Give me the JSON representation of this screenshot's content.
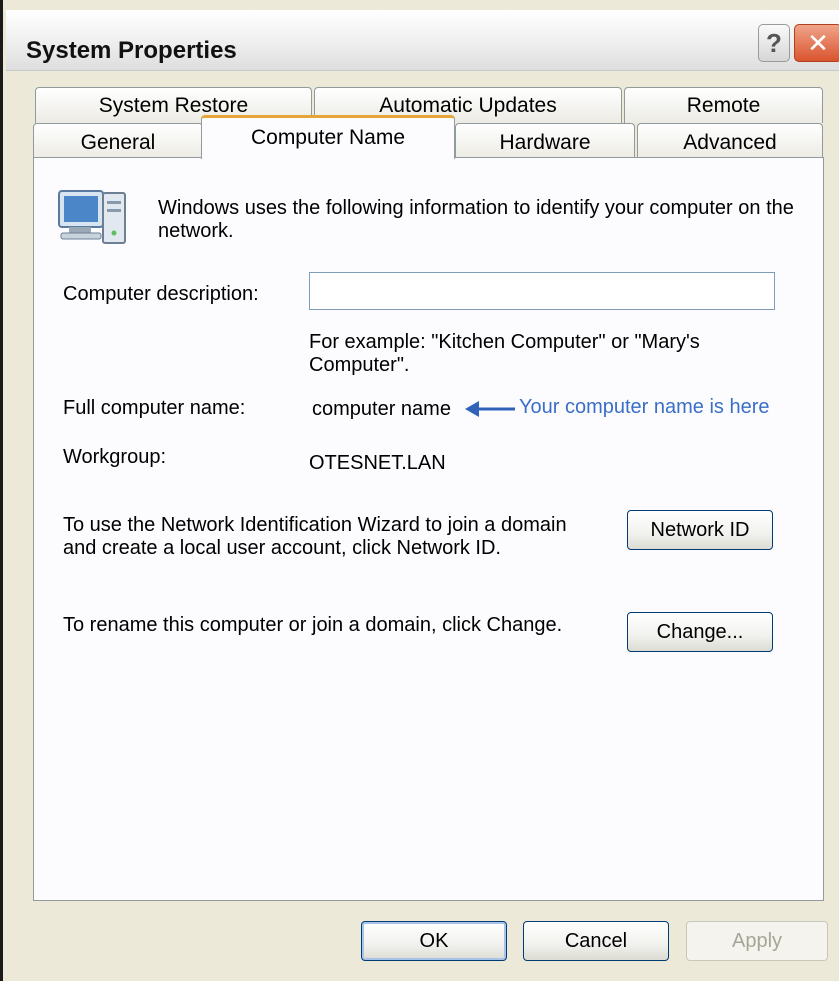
{
  "window": {
    "title": "System Properties",
    "help_glyph": "?",
    "close_glyph": "✕"
  },
  "tabs": {
    "row1": [
      "System Restore",
      "Automatic Updates",
      "Remote"
    ],
    "row2": [
      "General",
      "Computer Name",
      "Hardware",
      "Advanced"
    ],
    "active": "Computer Name"
  },
  "panel": {
    "intro": "Windows uses the following information to identify your computer on the network.",
    "description_label": "Computer description:",
    "description_value": "",
    "example_text": "For example: \"Kitchen Computer\" or \"Mary's Computer\".",
    "full_name_label": "Full computer name:",
    "full_name_value": "computer name",
    "annotation": "Your computer name is here",
    "workgroup_label": "Workgroup:",
    "workgroup_value": "OTESNET.LAN",
    "network_id_text": "To use the Network Identification Wizard to join a domain and create a local user account, click Network ID.",
    "network_id_button": "Network ID",
    "rename_text": "To rename this computer or join a domain, click Change.",
    "change_button": "Change..."
  },
  "footer": {
    "ok": "OK",
    "cancel": "Cancel",
    "apply": "Apply"
  },
  "colors": {
    "annotation": "#3a6fc7",
    "active_tab_accent": "#e6a53a",
    "dialog_bg": "#ece9d8"
  },
  "icons": {
    "computer": "computer-icon",
    "arrow": "arrow-left-icon"
  }
}
